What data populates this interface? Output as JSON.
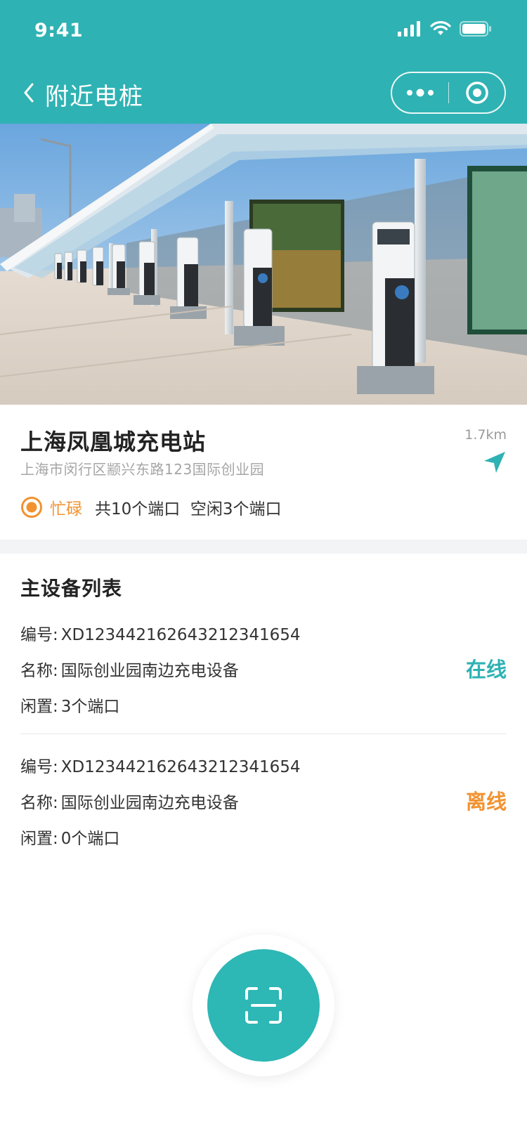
{
  "status_bar": {
    "time": "9:41"
  },
  "nav": {
    "title": "附近电桩"
  },
  "station": {
    "name": "上海凤凰城充电站",
    "address": "上海市闵行区颛兴东路123国际创业园",
    "distance": "1.7km",
    "status": "忙碌",
    "ports_summary": "共10个端口  空闲3个端口"
  },
  "devices": {
    "title": "主设备列表",
    "items": [
      {
        "id_label": "编号:",
        "id": "XD123442162643212341654",
        "name_label": "名称:",
        "name": "国际创业园南边充电设备",
        "idle_label": "闲置:",
        "idle": "3个端口",
        "state": "在线",
        "state_color": "#2fb2b3"
      },
      {
        "id_label": "编号:",
        "id": "XD123442162643212341654",
        "name_label": "名称:",
        "name": "国际创业园南边充电设备",
        "idle_label": "闲置:",
        "idle": "0个端口",
        "state": "离线",
        "state_color": "#f2922f"
      }
    ]
  },
  "colors": {
    "brand": "#2fb2b3",
    "busy": "#f2922f"
  },
  "icons": {
    "back": "chevron-left-icon",
    "more": "more-dots-icon",
    "target": "target-circle-icon",
    "navigate": "navigation-arrow-icon",
    "busy": "busy-status-icon",
    "scan": "scan-icon"
  }
}
